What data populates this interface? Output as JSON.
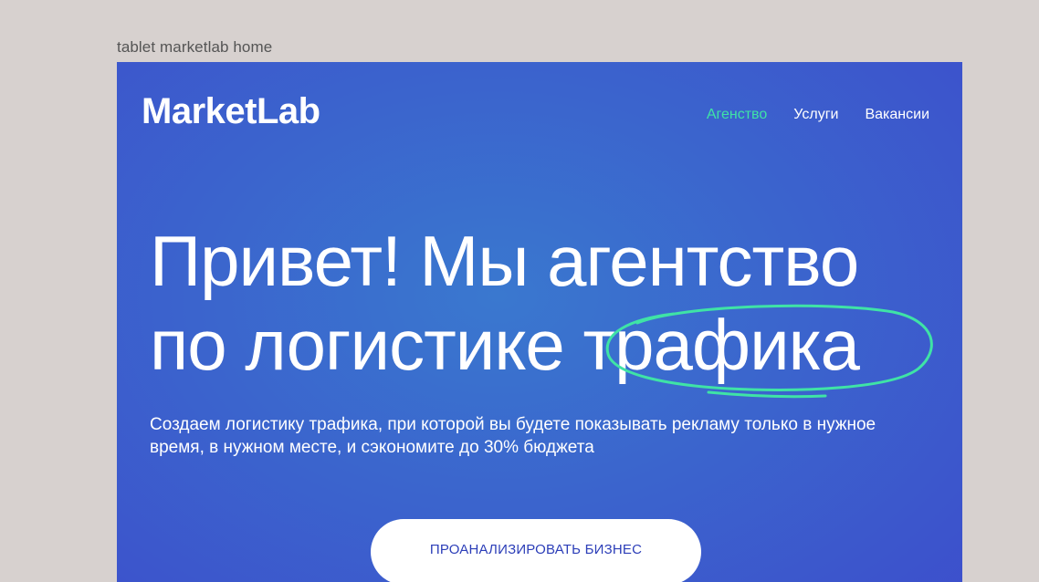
{
  "frame": {
    "label": "tablet marketlab home"
  },
  "header": {
    "logo": "MarketLab",
    "nav": [
      {
        "label": "Агенство",
        "active": true
      },
      {
        "label": "Услуги",
        "active": false
      },
      {
        "label": "Вакансии",
        "active": false
      }
    ]
  },
  "hero": {
    "line1": "Привет! Мы агентство",
    "line2_prefix": "по логистике ",
    "line2_highlight": "трафика",
    "subtitle": "Создаем логистику трафика, при которой вы будете показывать рекламу только в нужное время, в нужном месте, и сэкономите до 30% бюджета",
    "cta_label": "ПРОАНАЛИЗИРОВАТЬ БИЗНЕС"
  },
  "colors": {
    "background": "#d7d1cf",
    "hero_blue": "#3b64cd",
    "accent_green": "#3fe3a6",
    "cta_text": "#2c3eb8"
  }
}
